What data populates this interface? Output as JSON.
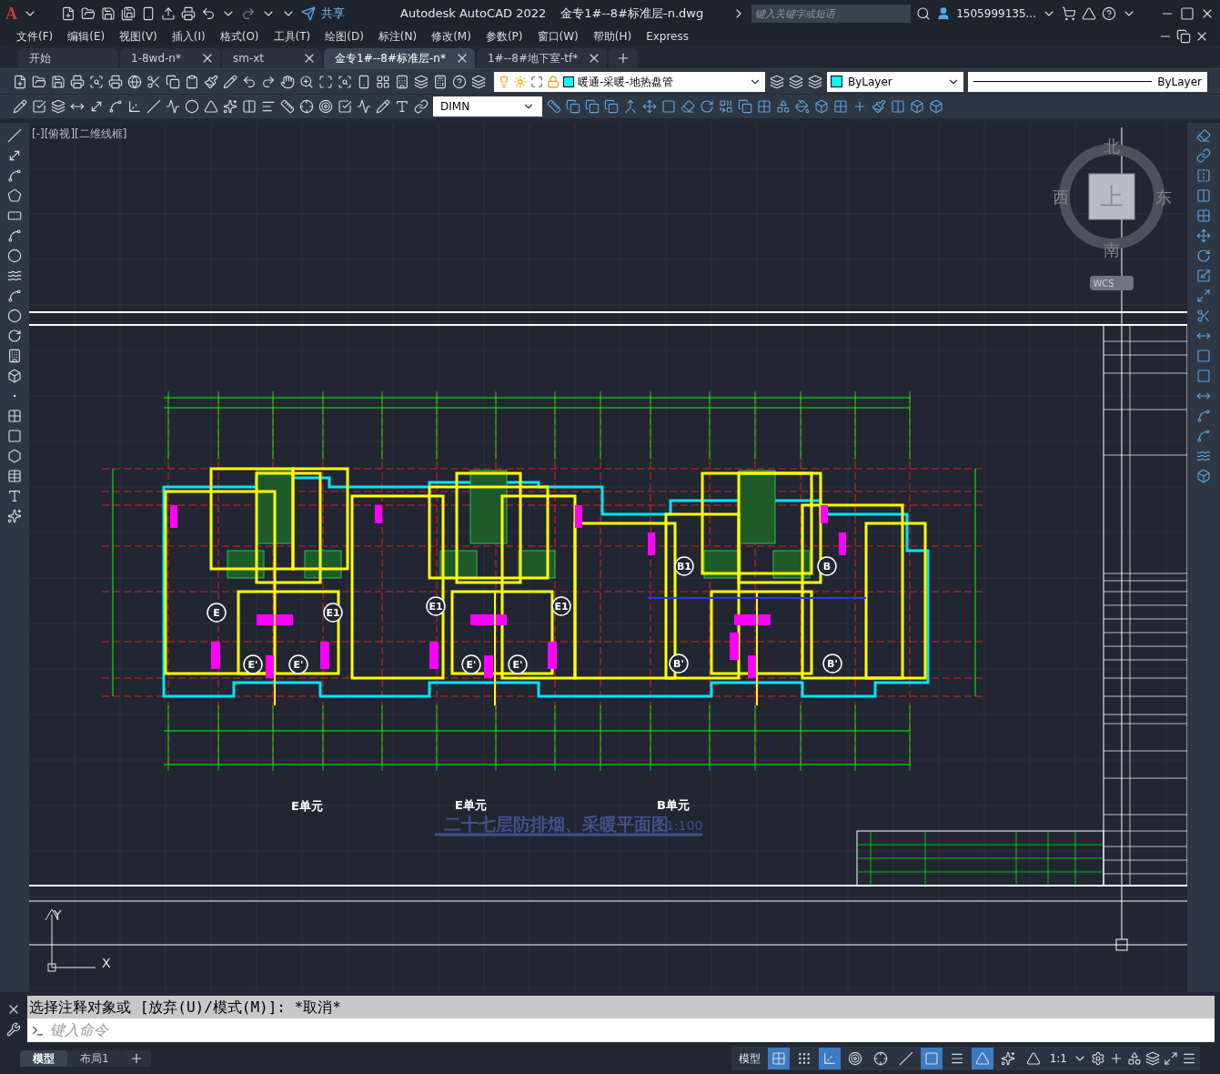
{
  "title_bar": {
    "logo": "A",
    "share": "共享",
    "app_title": "Autodesk AutoCAD 2022",
    "file_name": "金专1#--8#标准层-n.dwg",
    "search": {
      "placeholder": "键入关键字或短语"
    },
    "user": "1505999135..."
  },
  "menu_bar": [
    "文件(F)",
    "编辑(E)",
    "视图(V)",
    "插入(I)",
    "格式(O)",
    "工具(T)",
    "绘图(D)",
    "标注(N)",
    "修改(M)",
    "参数(P)",
    "窗口(W)",
    "帮助(H)",
    "Express"
  ],
  "doc_tabs": [
    {
      "label": "开始",
      "closable": false,
      "selected": false
    },
    {
      "label": "1-8wd-n*",
      "closable": true,
      "selected": false
    },
    {
      "label": "sm-xt",
      "closable": true,
      "selected": false
    },
    {
      "label": "金专1#--8#标准层-n*",
      "closable": true,
      "selected": true
    },
    {
      "label": "1#--8#地下室-tf*",
      "closable": true,
      "selected": false
    }
  ],
  "layer_toolbar": {
    "layer": "暖通-采暖-地热盘管",
    "color_control": "ByLayer",
    "linetype": "ByLayer"
  },
  "dim_style": "DIMN",
  "viewport": {
    "label": "[-][俯视][二维线框]"
  },
  "viewcube": {
    "north": "北",
    "south": "南",
    "west": "西",
    "east": "东",
    "face": "上",
    "ucs": "WCS"
  },
  "ucs_icon": {
    "y": "Y",
    "x": "X"
  },
  "drawing": {
    "unit_labels": [
      "E单元",
      "E单元",
      "B单元"
    ],
    "title": "二十七层防排烟、采暖平面图",
    "scale": "1:100",
    "markers": [
      "E",
      "E1",
      "E1",
      "E1",
      "E'",
      "E'",
      "E'",
      "E'",
      "B1",
      "B",
      "B'",
      "B'"
    ]
  },
  "command_line": {
    "history": "选择注释对象或 [放弃(U)/模式(M)]: *取消*",
    "placeholder": "键入命令"
  },
  "layout_tabs": [
    {
      "label": "模型",
      "selected": true
    },
    {
      "label": "布局1",
      "selected": false
    }
  ],
  "status_bar": {
    "space": "模型",
    "scale": "1:1",
    "toggles": [
      {
        "kind": "grid",
        "on": true
      },
      {
        "kind": "snap",
        "on": false
      },
      {
        "kind": "ortho",
        "on": true
      },
      {
        "kind": "polar",
        "on": false
      },
      {
        "kind": "track",
        "on": false
      },
      {
        "kind": "angle",
        "on": false
      },
      {
        "kind": "osnap",
        "on": true
      },
      {
        "kind": "lineweight",
        "on": false
      },
      {
        "kind": "annotation",
        "on": true
      },
      {
        "kind": "autoscale",
        "on": false
      },
      {
        "kind": "annoscale",
        "on": false
      }
    ]
  }
}
